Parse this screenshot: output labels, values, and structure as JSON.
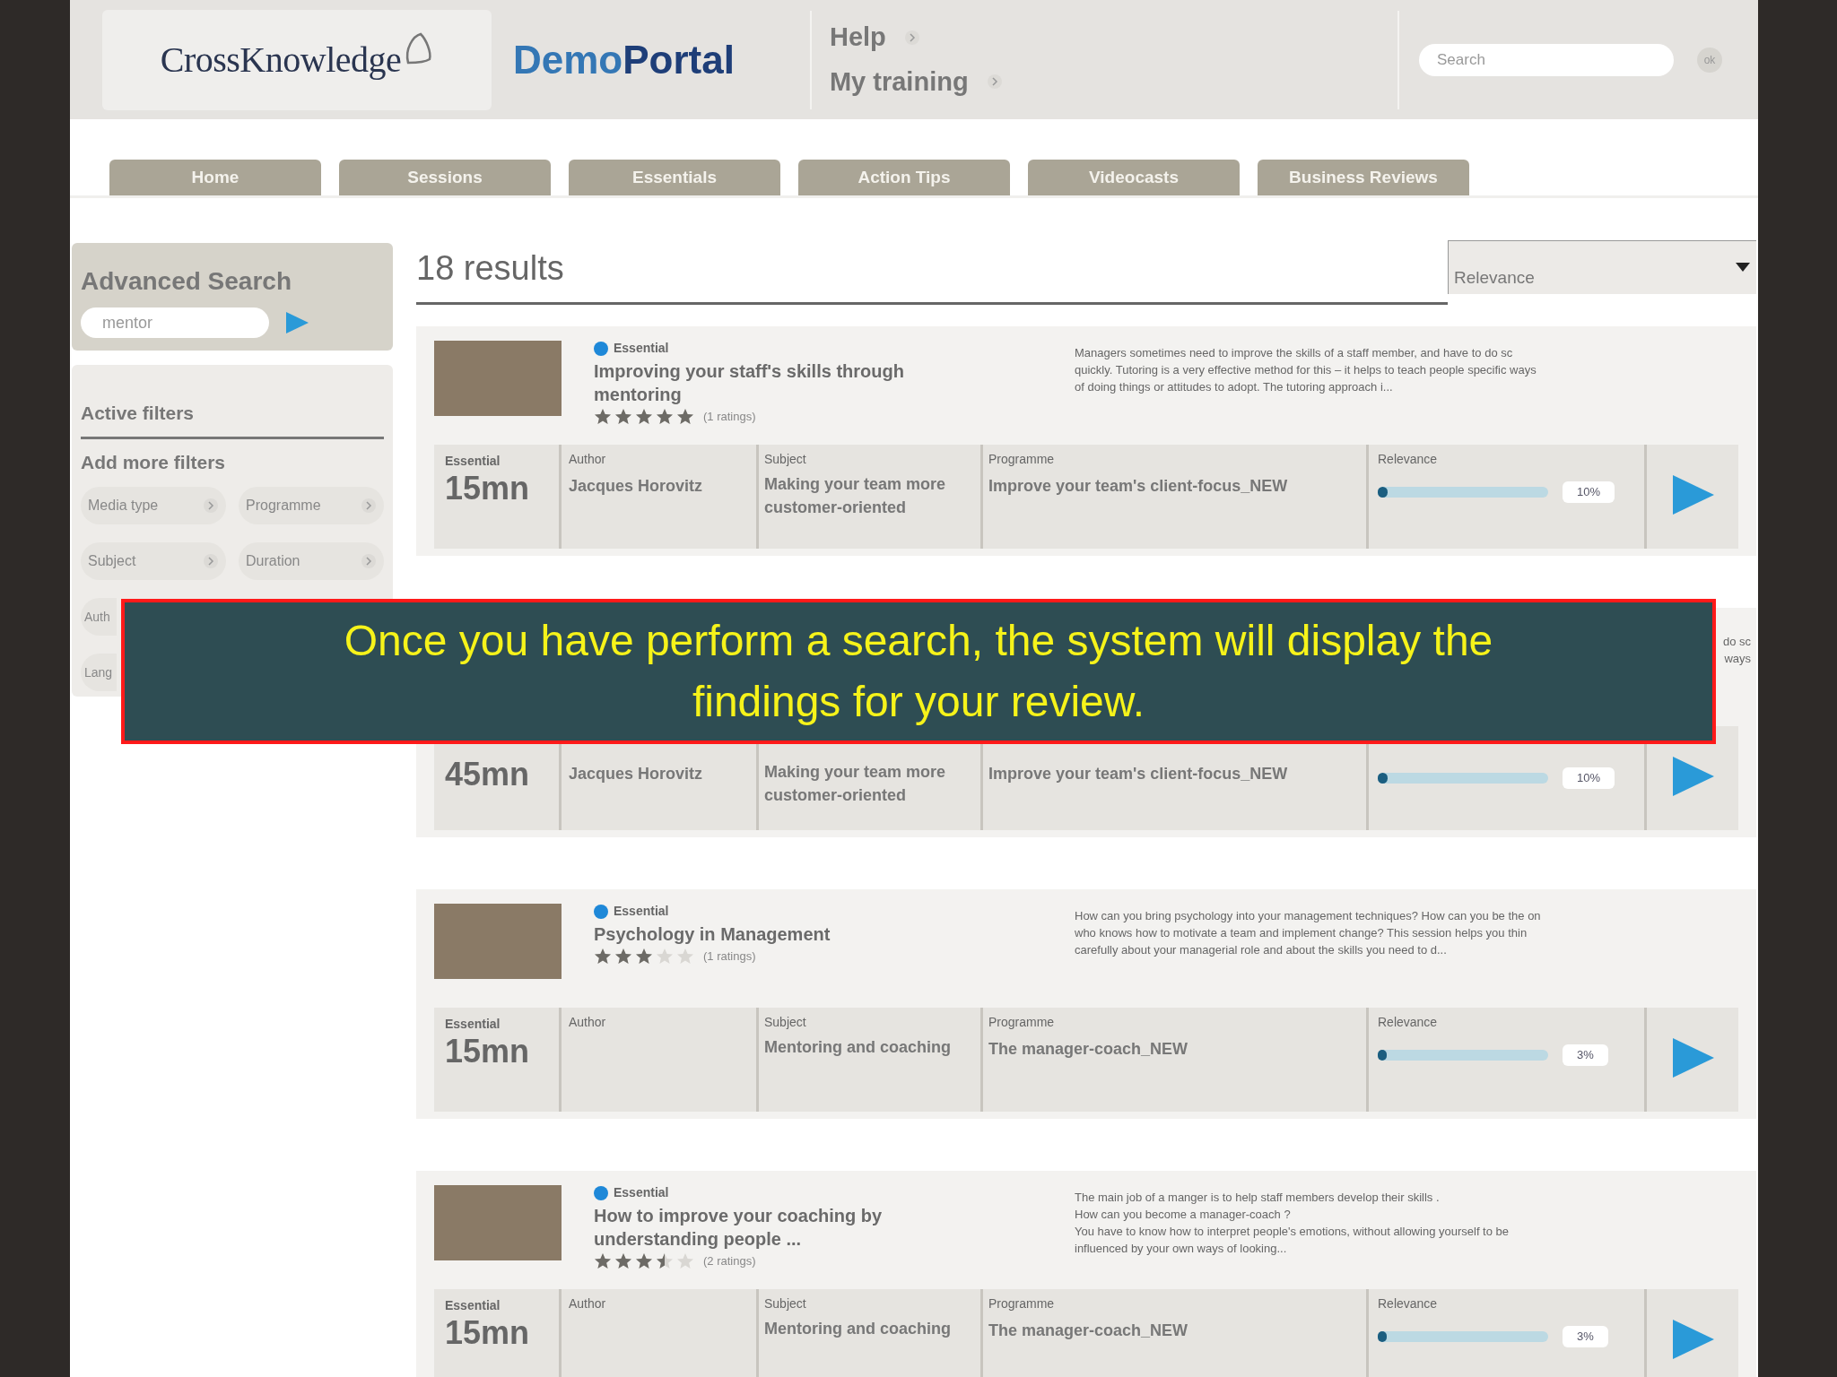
{
  "header": {
    "logo": "CrossKnowledge",
    "portal": [
      "Demo",
      "Portal"
    ],
    "links": [
      "Help",
      "My training"
    ],
    "search": {
      "placeholder": "Search",
      "button": "ok"
    }
  },
  "tabs": [
    "Home",
    "Sessions",
    "Essentials",
    "Action Tips",
    "Videocasts",
    "Business Reviews"
  ],
  "sidebar": {
    "title": "Advanced Search",
    "query": "mentor",
    "active_filters": "Active filters",
    "add_filters": "Add more filters",
    "filters": [
      {
        "kind": "pill",
        "label": "Media type"
      },
      {
        "kind": "pill",
        "label": "Programme"
      },
      {
        "kind": "pill",
        "label": "Subject"
      },
      {
        "kind": "pill",
        "label": "Duration"
      },
      {
        "kind": "stub",
        "label": "Auth"
      },
      {
        "kind": "stub",
        "label": "Lang"
      }
    ]
  },
  "results": {
    "count": "18 results",
    "sort": "Relevance",
    "items": [
      {
        "kind": "full",
        "type": "Essential",
        "title": "Improving your staff's skills through mentoring",
        "stars": 5,
        "ratings": "(1 ratings)",
        "description": [
          "Managers sometimes need to improve the skills of a staff member, and have to do sc",
          "quickly. Tutoring is a very effective method for this – it helps to teach people specific ways",
          "of doing things or attitudes to adopt. The tutoring approach i..."
        ],
        "card_type": "Essential",
        "duration": "15mn",
        "author_label": "Author",
        "author": "Jacques Horovitz",
        "subject_label": "Subject",
        "subject": "Making your team more customer-oriented",
        "programme_label": "Programme",
        "programme": "Improve your team's client-focus_NEW",
        "relevance_label": "Relevance",
        "reading": "10%",
        "level": 0.06
      },
      {
        "kind": "partial",
        "description": [
          "do sc",
          "ways"
        ],
        "duration": "45mn",
        "author": "Jacques Horovitz",
        "subject": "Making your team more customer-oriented",
        "programme": "Improve your team's client-focus_NEW",
        "reading": "10%",
        "level": 0.06
      },
      {
        "kind": "full",
        "type": "Essential",
        "title": "Psychology in Management",
        "stars": 3,
        "ratings": "(1 ratings)",
        "description": [
          "How can you bring psychology into your management techniques? How can you be the on",
          "who knows how to motivate a team and implement change? This session helps you thin",
          "carefully about your managerial role and about the skills you need to d..."
        ],
        "card_type": "Essential",
        "duration": "15mn",
        "author_label": "Author",
        "subject_label": "Subject",
        "subject": "Mentoring and coaching",
        "programme_label": "Programme",
        "programme": "The manager-coach_NEW",
        "relevance_label": "Relevance",
        "reading": "3%",
        "level": 0.05
      },
      {
        "kind": "full",
        "type": "Essential",
        "title": "How to improve your coaching by understanding people ...",
        "stars": 3.5,
        "ratings": "(2 ratings)",
        "description": [
          "The main job of a manger is to help staff members develop their skills .",
          "How can you become a manager-coach ?",
          "You have to know how to interpret people's emotions,  without allowing yourself to be",
          "influenced by your own ways of looking..."
        ],
        "card_type": "Essential",
        "duration": "15mn",
        "author_label": "Author",
        "subject_label": "Subject",
        "subject": "Mentoring and coaching",
        "programme_label": "Programme",
        "programme": "The manager-coach_NEW",
        "relevance_label": "Relevance",
        "reading": "3%",
        "level": 0.05
      }
    ]
  },
  "caption": "Once you have perform a search, the system will display the findings for your review."
}
